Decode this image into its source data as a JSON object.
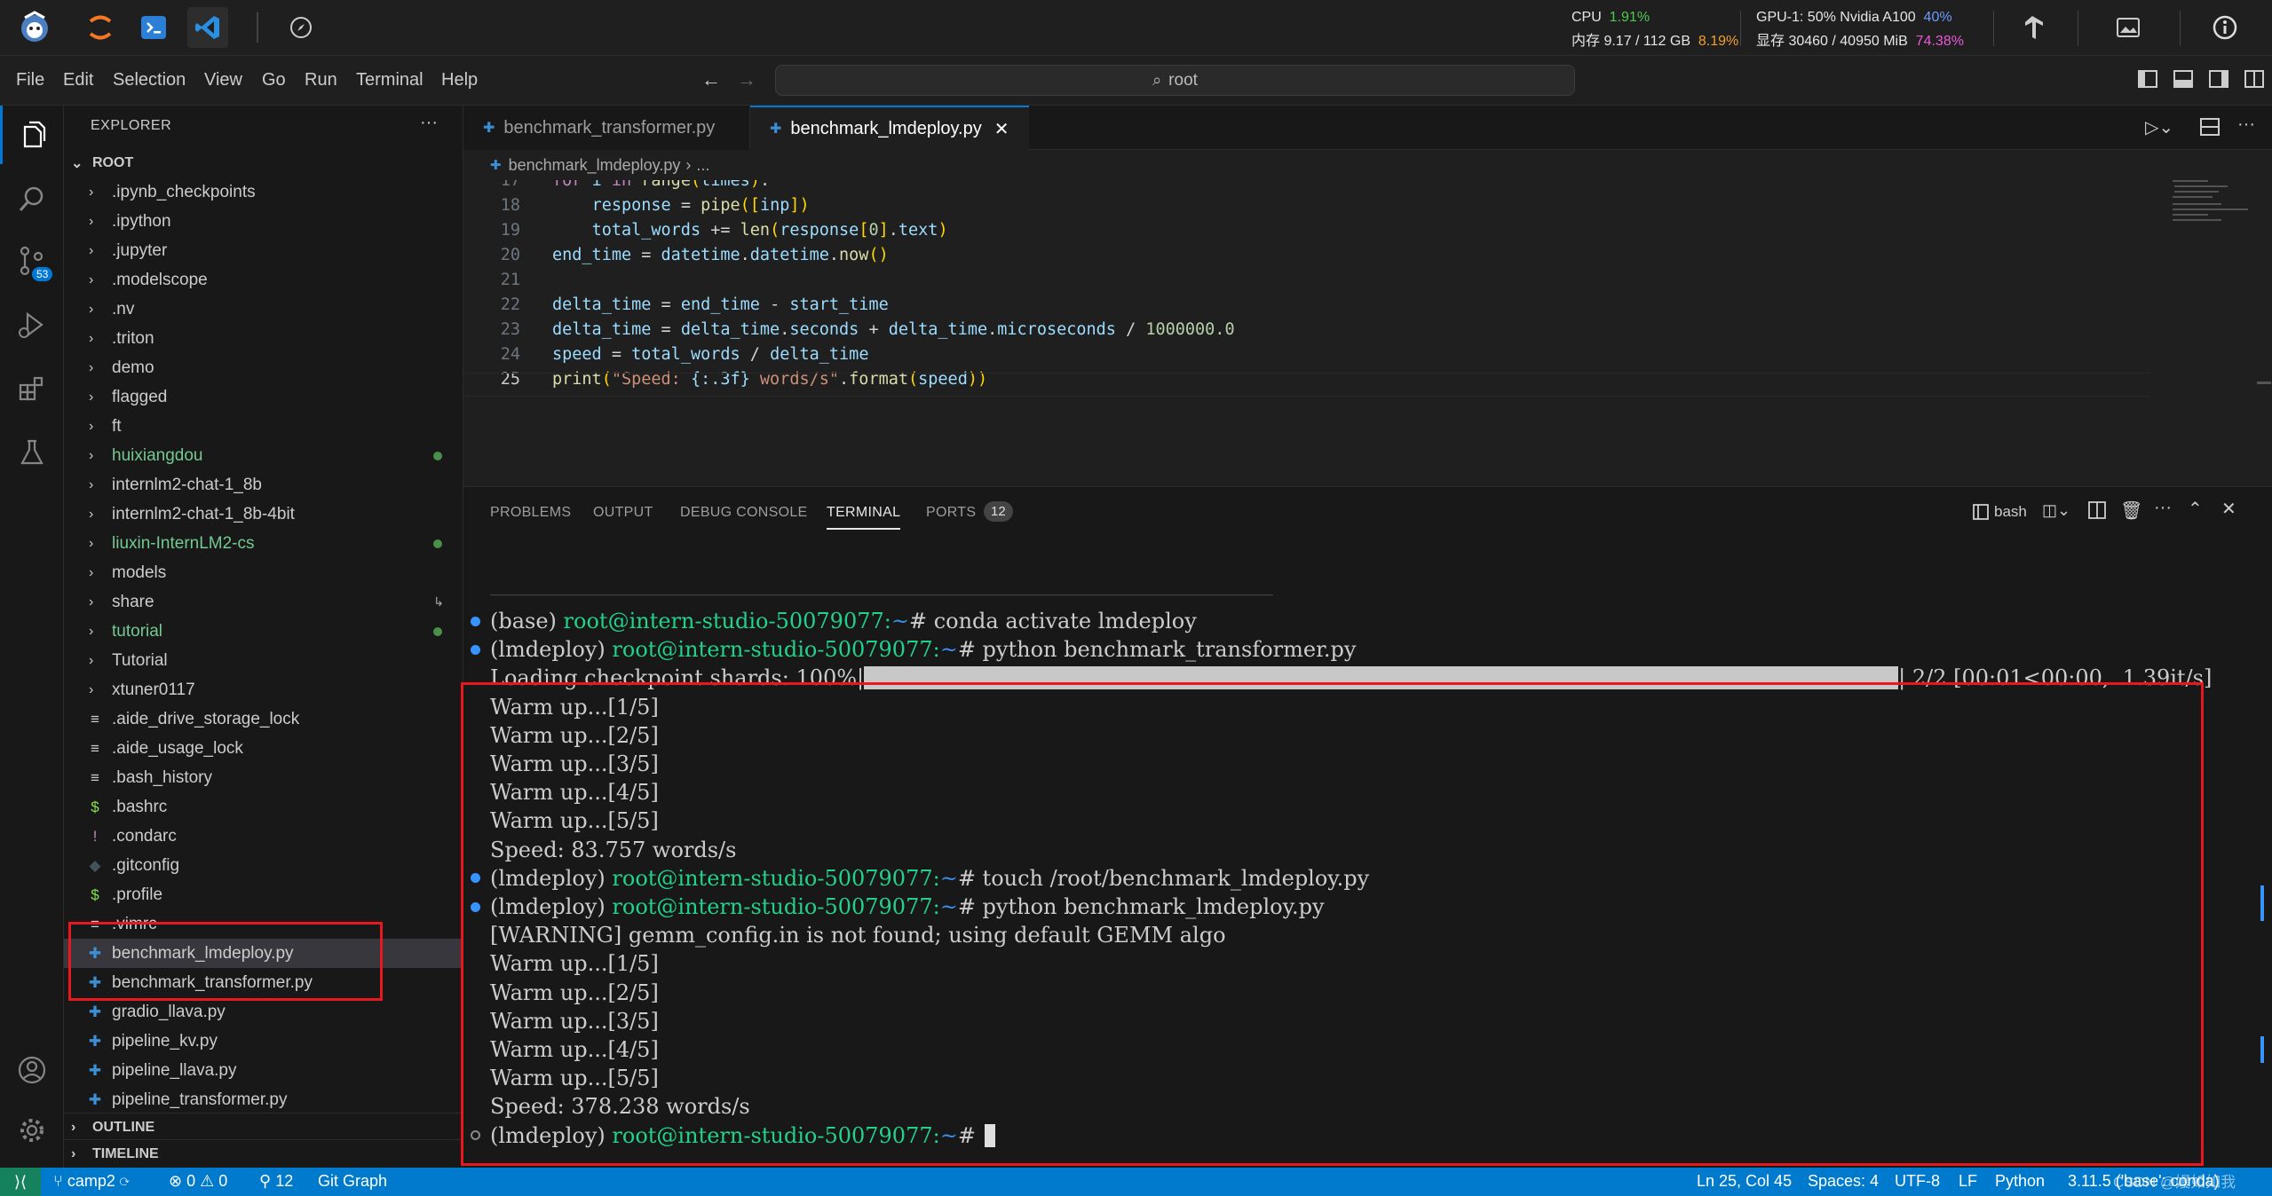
{
  "topbar": {
    "cpu_label": "CPU",
    "cpu_value": "1.91%",
    "mem_label": "内存 9.17 / 112 GB",
    "mem_pct": "8.19%",
    "gpu_label": "GPU-1: 50% Nvidia A100",
    "gpu_pct": "40%",
    "vram_label": "显存 30460 / 40950 MiB",
    "vram_pct": "74.38%"
  },
  "menu": [
    "File",
    "Edit",
    "Selection",
    "View",
    "Go",
    "Run",
    "Terminal",
    "Help"
  ],
  "command_center": "root",
  "activity": {
    "scm_badge": "53"
  },
  "explorer": {
    "title": "EXPLORER",
    "root": "ROOT",
    "items": [
      {
        "label": ".ipynb_checkpoints",
        "type": "folder"
      },
      {
        "label": ".ipython",
        "type": "folder"
      },
      {
        "label": ".jupyter",
        "type": "folder"
      },
      {
        "label": ".modelscope",
        "type": "folder"
      },
      {
        "label": ".nv",
        "type": "folder"
      },
      {
        "label": ".triton",
        "type": "folder"
      },
      {
        "label": "demo",
        "type": "folder"
      },
      {
        "label": "flagged",
        "type": "folder"
      },
      {
        "label": "ft",
        "type": "folder"
      },
      {
        "label": "huixiangdou",
        "type": "folder",
        "color": "#73c991",
        "dot": true
      },
      {
        "label": "internlm2-chat-1_8b",
        "type": "folder"
      },
      {
        "label": "internlm2-chat-1_8b-4bit",
        "type": "folder"
      },
      {
        "label": "liuxin-InternLM2-cs",
        "type": "folder",
        "color": "#73c991",
        "dot": true
      },
      {
        "label": "models",
        "type": "folder"
      },
      {
        "label": "share",
        "type": "folder",
        "link": true
      },
      {
        "label": "tutorial",
        "type": "folder",
        "color": "#73c991",
        "dot": true
      },
      {
        "label": "Tutorial",
        "type": "folder"
      },
      {
        "label": "xtuner0117",
        "type": "folder"
      },
      {
        "label": ".aide_drive_storage_lock",
        "type": "file",
        "icon": "≡",
        "iconColor": "#cccccc"
      },
      {
        "label": ".aide_usage_lock",
        "type": "file",
        "icon": "≡",
        "iconColor": "#cccccc"
      },
      {
        "label": ".bash_history",
        "type": "file",
        "icon": "≡",
        "iconColor": "#cccccc"
      },
      {
        "label": ".bashrc",
        "type": "file",
        "icon": "$",
        "iconColor": "#89e051"
      },
      {
        "label": ".condarc",
        "type": "file",
        "icon": "!",
        "iconColor": "#c586c0"
      },
      {
        "label": ".gitconfig",
        "type": "file",
        "icon": "◆",
        "iconColor": "#41535b"
      },
      {
        "label": ".profile",
        "type": "file",
        "icon": "$",
        "iconColor": "#89e051"
      },
      {
        "label": ".vimrc",
        "type": "file",
        "icon": "≡",
        "iconColor": "#cccccc"
      },
      {
        "label": "benchmark_lmdeploy.py",
        "type": "file",
        "icon": "✚",
        "iconColor": "#3b8fd6",
        "selected": true
      },
      {
        "label": "benchmark_transformer.py",
        "type": "file",
        "icon": "✚",
        "iconColor": "#3b8fd6"
      },
      {
        "label": "gradio_llava.py",
        "type": "file",
        "icon": "✚",
        "iconColor": "#3b8fd6"
      },
      {
        "label": "pipeline_kv.py",
        "type": "file",
        "icon": "✚",
        "iconColor": "#3b8fd6"
      },
      {
        "label": "pipeline_llava.py",
        "type": "file",
        "icon": "✚",
        "iconColor": "#3b8fd6"
      },
      {
        "label": "pipeline_transformer.py",
        "type": "file",
        "icon": "✚",
        "iconColor": "#3b8fd6"
      }
    ],
    "outline": "OUTLINE",
    "timeline": "TIMELINE"
  },
  "tabs": [
    {
      "label": "benchmark_transformer.py",
      "active": false
    },
    {
      "label": "benchmark_lmdeploy.py",
      "active": true
    }
  ],
  "breadcrumb": {
    "file": "benchmark_lmdeploy.py",
    "more": "..."
  },
  "code": [
    {
      "n": "17",
      "t": "for i in range(times):"
    },
    {
      "n": "18",
      "t": "    response = pipe([inp])"
    },
    {
      "n": "19",
      "t": "    total_words += len(response[0].text)"
    },
    {
      "n": "20",
      "t": "end_time = datetime.datetime.now()"
    },
    {
      "n": "21",
      "t": ""
    },
    {
      "n": "22",
      "t": "delta_time = end_time - start_time"
    },
    {
      "n": "23",
      "t": "delta_time = delta_time.seconds + delta_time.microseconds / 1000000.0"
    },
    {
      "n": "24",
      "t": "speed = total_words / delta_time"
    },
    {
      "n": "25",
      "t": "print(\"Speed: {:.3f} words/s\".format(speed))"
    }
  ],
  "panel": {
    "tabs": [
      "PROBLEMS",
      "OUTPUT",
      "DEBUG CONSOLE",
      "TERMINAL",
      "PORTS"
    ],
    "ports_count": "12",
    "shell": "bash"
  },
  "terminal": {
    "separator": "______________________________________________________________________________________________________________________________",
    "lines": [
      {
        "dot": "blue",
        "env": "(base) ",
        "prompt": "root@intern-studio-50079077:",
        "path": "~",
        "cmd": "# conda activate lmdeploy"
      },
      {
        "dot": "blue",
        "env": "(lmdeploy) ",
        "prompt": "root@intern-studio-50079077:",
        "path": "~",
        "cmd": "# python benchmark_transformer.py"
      },
      {
        "text": "Loading checkpoint shards: 100%|",
        "progress": 1.0,
        "suffix": "| 2/2 [00:01<00:00,  1.39it/s]"
      },
      {
        "text": "Warm up...[1/5]"
      },
      {
        "text": "Warm up...[2/5]"
      },
      {
        "text": "Warm up...[3/5]"
      },
      {
        "text": "Warm up...[4/5]"
      },
      {
        "text": "Warm up...[5/5]"
      },
      {
        "text": "Speed: 83.757 words/s"
      },
      {
        "dot": "blue",
        "env": "(lmdeploy) ",
        "prompt": "root@intern-studio-50079077:",
        "path": "~",
        "cmd": "# touch /root/benchmark_lmdeploy.py"
      },
      {
        "dot": "blue",
        "env": "(lmdeploy) ",
        "prompt": "root@intern-studio-50079077:",
        "path": "~",
        "cmd": "# python benchmark_lmdeploy.py"
      },
      {
        "text": "[WARNING] gemm_config.in is not found; using default GEMM algo"
      },
      {
        "text": "Warm up...[1/5]"
      },
      {
        "text": "Warm up...[2/5]"
      },
      {
        "text": "Warm up...[3/5]"
      },
      {
        "text": "Warm up...[4/5]"
      },
      {
        "text": "Warm up...[5/5]"
      },
      {
        "text": "Speed: 378.238 words/s"
      },
      {
        "dot": "hollow",
        "env": "(lmdeploy) ",
        "prompt": "root@intern-studio-50079077:",
        "path": "~",
        "cmd": "# ",
        "cursor": true
      }
    ]
  },
  "statusbar": {
    "branch": "camp2",
    "errors": "0",
    "warnings": "0",
    "ports": "12",
    "git_graph": "Git Graph",
    "position": "Ln 25, Col 45",
    "spaces": "Spaces: 4",
    "encoding": "UTF-8",
    "eol": "LF",
    "language": "Python",
    "interpreter": "3.11.5 ('base': conda)",
    "watermark": "CSDN @嫚如如我"
  }
}
